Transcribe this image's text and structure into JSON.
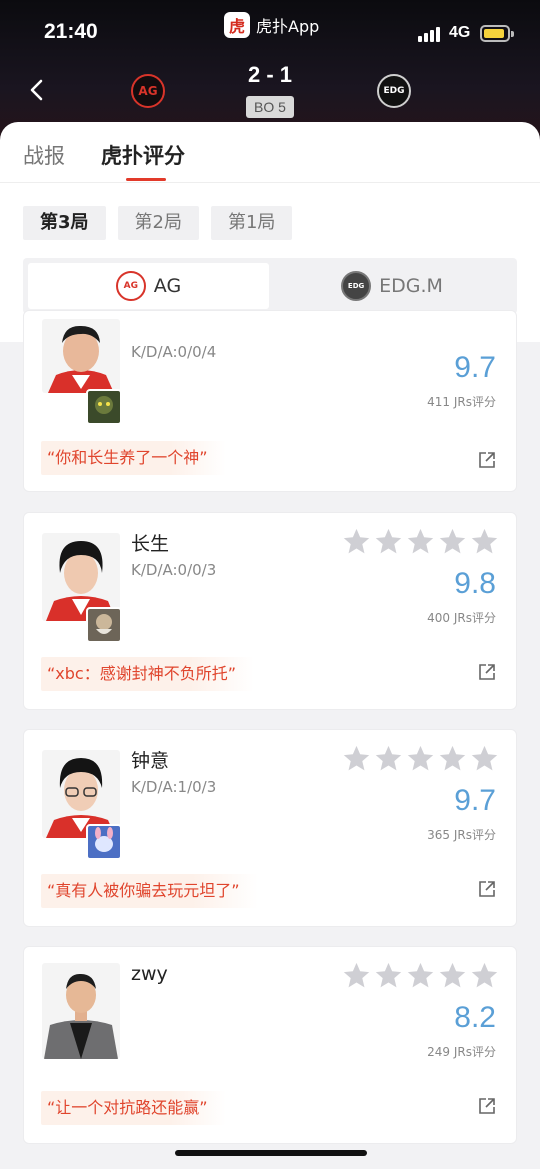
{
  "status": {
    "time": "21:40",
    "app_name": "虎扑App",
    "app_icon_glyph": "虎",
    "network": "4G"
  },
  "match": {
    "score": "2 - 1",
    "format": "BO 5",
    "team_left_logo_text": "AG",
    "team_right_logo_text": "EDG"
  },
  "tabs": [
    {
      "label": "战报"
    },
    {
      "label": "虎扑评分"
    }
  ],
  "games": [
    {
      "label": "第3局"
    },
    {
      "label": "第2局"
    },
    {
      "label": "第1局"
    }
  ],
  "teams": [
    {
      "name": "AG",
      "logo_text": "AG"
    },
    {
      "name": "EDG.M",
      "logo_text": "EDG"
    }
  ],
  "players": [
    {
      "name": "",
      "kda": "K/D/A:0/0/4",
      "score": "9.7",
      "ratings": "411 JRs评分",
      "quote": "“你和长生养了一个神”"
    },
    {
      "name": "长生",
      "kda": "K/D/A:0/0/3",
      "score": "9.8",
      "ratings": "400 JRs评分",
      "quote": "“xbc：感谢封神不负所托”"
    },
    {
      "name": "钟意",
      "kda": "K/D/A:1/0/3",
      "score": "9.7",
      "ratings": "365 JRs评分",
      "quote": "“真有人被你骗去玩元坦了”"
    },
    {
      "name": "zwy",
      "kda": "",
      "score": "8.2",
      "ratings": "249 JRs评分",
      "quote": "“让一个对抗路还能赢”"
    }
  ],
  "colors": {
    "accent": "#e23a2a",
    "score_blue": "#5a9fd6",
    "quote_orange": "#e0452d",
    "star_gray": "#cfcfd4"
  }
}
